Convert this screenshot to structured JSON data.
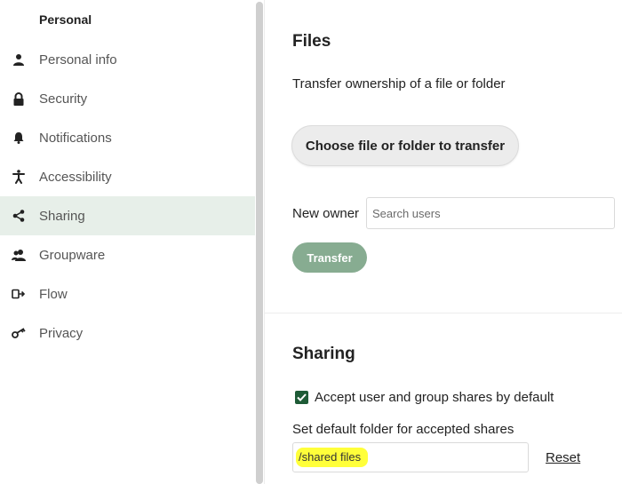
{
  "sidebar": {
    "heading": "Personal",
    "items": [
      {
        "label": "Personal info",
        "icon": "user-icon"
      },
      {
        "label": "Security",
        "icon": "lock-icon"
      },
      {
        "label": "Notifications",
        "icon": "bell-icon"
      },
      {
        "label": "Accessibility",
        "icon": "accessibility-icon"
      },
      {
        "label": "Sharing",
        "icon": "share-icon",
        "active": true
      },
      {
        "label": "Groupware",
        "icon": "contacts-icon"
      },
      {
        "label": "Flow",
        "icon": "flow-icon"
      },
      {
        "label": "Privacy",
        "icon": "key-icon"
      }
    ]
  },
  "files": {
    "title": "Files",
    "description": "Transfer ownership of a file or folder",
    "choose_label": "Choose file or folder to transfer",
    "new_owner_label": "New owner",
    "search_placeholder": "Search users",
    "transfer_label": "Transfer"
  },
  "sharing": {
    "title": "Sharing",
    "accept_label": "Accept user and group shares by default",
    "accept_checked": true,
    "folder_label": "Set default folder for accepted shares",
    "folder_value": "/shared files",
    "reset_label": "Reset"
  },
  "colors": {
    "active_item_bg": "#e7efe9",
    "primary_button": "#87ac91",
    "checkbox": "#1e5b36",
    "highlight": "#ffff3a"
  }
}
